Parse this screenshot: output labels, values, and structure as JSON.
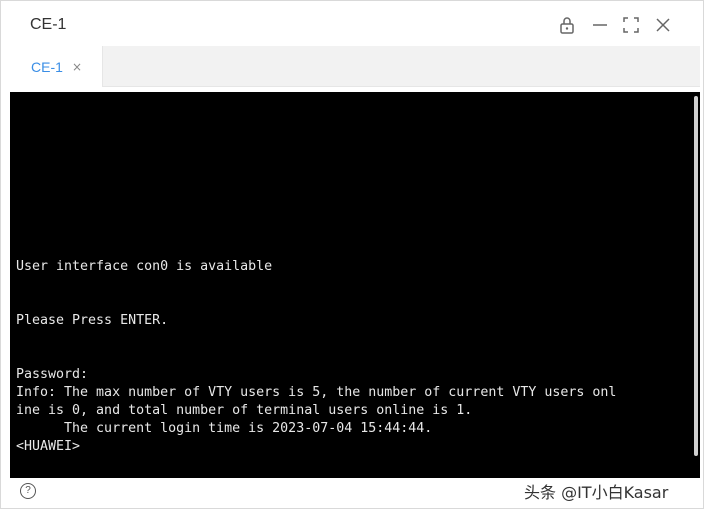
{
  "window": {
    "title": "CE-1"
  },
  "title_controls": {
    "lock": "lock-icon",
    "minimize": "minimize-icon",
    "maximize": "maximize-icon",
    "close": "close-icon"
  },
  "tabs": [
    {
      "label": "CE-1",
      "close": "×",
      "active": true
    }
  ],
  "terminal": {
    "lines": [
      "User interface con0 is available",
      "",
      "",
      "Please Press ENTER.",
      "",
      "",
      "Password:",
      "Info: The max number of VTY users is 5, the number of current VTY users onl",
      "ine is 0, and total number of terminal users online is 1.",
      "      The current login time is 2023-07-04 15:44:44.",
      "<HUAWEI>"
    ]
  },
  "footer": {
    "help": "?",
    "watermark": "头条 @IT小白Kasar"
  },
  "colors": {
    "accent": "#3a8ee6",
    "terminal_bg": "#000000",
    "terminal_fg": "#e8e8e8"
  }
}
